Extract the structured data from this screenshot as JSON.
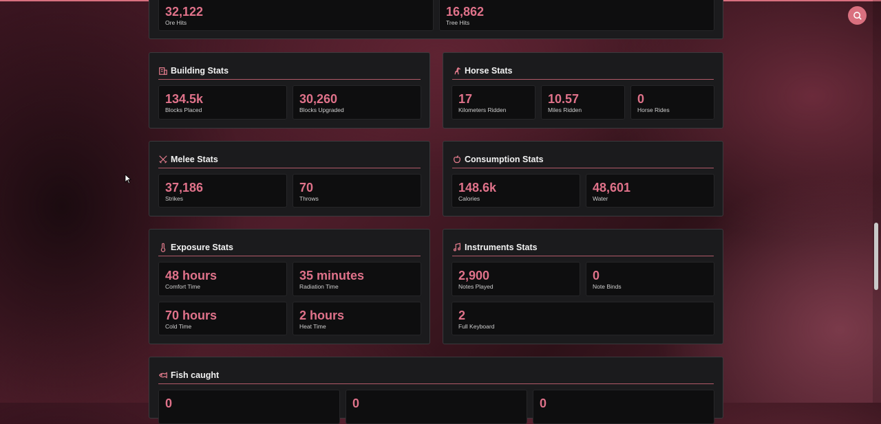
{
  "top_row": [
    {
      "value": "32,122",
      "label": "Ore Hits"
    },
    {
      "value": "16,862",
      "label": "Tree Hits"
    }
  ],
  "building": {
    "title": "Building Stats",
    "icon": "building-icon",
    "stats": [
      {
        "value": "134.5k",
        "label": "Blocks Placed"
      },
      {
        "value": "30,260",
        "label": "Blocks Upgraded"
      }
    ]
  },
  "horse": {
    "title": "Horse Stats",
    "icon": "horse-icon",
    "stats": [
      {
        "value": "17",
        "label": "Kilometers Ridden"
      },
      {
        "value": "10.57",
        "label": "Miles Ridden"
      },
      {
        "value": "0",
        "label": "Horse Rides"
      }
    ]
  },
  "melee": {
    "title": "Melee Stats",
    "icon": "swords-icon",
    "stats": [
      {
        "value": "37,186",
        "label": "Strikes"
      },
      {
        "value": "70",
        "label": "Throws"
      }
    ]
  },
  "consumption": {
    "title": "Consumption Stats",
    "icon": "apple-icon",
    "stats": [
      {
        "value": "148.6k",
        "label": "Calories"
      },
      {
        "value": "48,601",
        "label": "Water"
      }
    ]
  },
  "exposure": {
    "title": "Exposure Stats",
    "icon": "thermometer-icon",
    "stats": [
      {
        "value": "48 hours",
        "label": "Comfort Time"
      },
      {
        "value": "35 minutes",
        "label": "Radiation Time"
      },
      {
        "value": "70 hours",
        "label": "Cold Time"
      },
      {
        "value": "2 hours",
        "label": "Heat Time"
      }
    ]
  },
  "instruments": {
    "title": "Instruments Stats",
    "icon": "music-note-icon",
    "stats": [
      {
        "value": "2,900",
        "label": "Notes Played"
      },
      {
        "value": "0",
        "label": "Note Binds"
      },
      {
        "value": "2",
        "label": "Full Keyboard"
      }
    ]
  },
  "fish": {
    "title": "Fish caught",
    "icon": "fish-icon",
    "stats": [
      {
        "value": "0"
      },
      {
        "value": "0"
      },
      {
        "value": "0"
      }
    ]
  },
  "colors": {
    "accent": "#e0728a",
    "card_bg": "#1b1b1d",
    "tile_bg": "#0e0e0f",
    "button": "#d9707f"
  },
  "search": {
    "icon": "search-icon"
  }
}
